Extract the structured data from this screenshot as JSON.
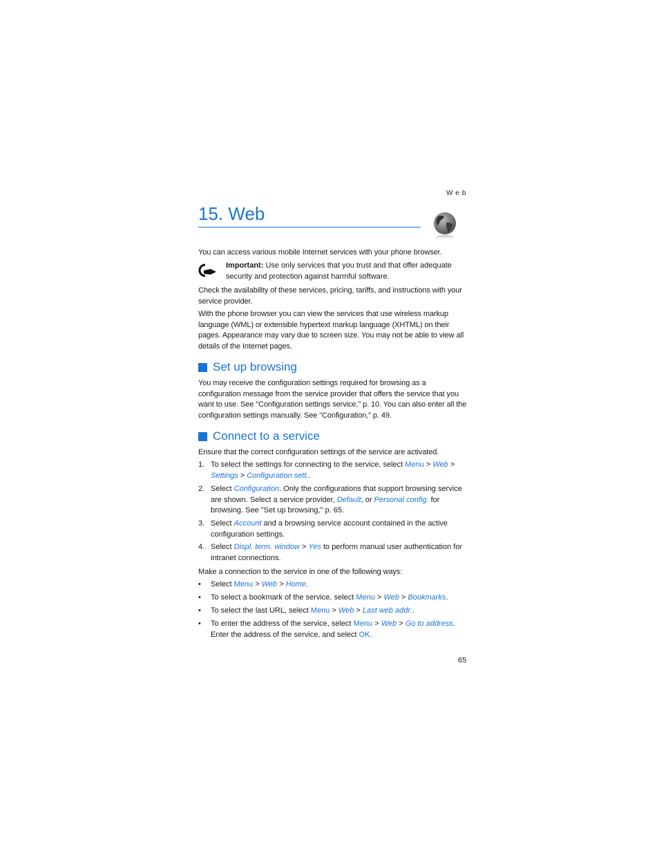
{
  "running_head": "Web",
  "chapter": {
    "title": "15. Web",
    "icon": "globe-icon"
  },
  "intro": "You can access various mobile Internet services with your phone browser.",
  "important": {
    "icon": "important-hand-icon",
    "label": "Important:",
    "text": " Use only services that you trust and that offer adequate security and protection against harmful software."
  },
  "para_check": "Check the availability of these services, pricing, tariffs, and instructions with your service provider.",
  "para_browser": "With the phone browser you can view the services that use wireless markup language (WML) or extensible hypertext markup language (XHTML) on their pages. Appearance may vary due to screen size. You may not be able to view all details of the Internet pages.",
  "sections": {
    "setup": {
      "heading": "Set up browsing",
      "text": "You may receive the configuration settings required for browsing as a configuration message from the service provider that offers the service that you want to use. See \"Configuration settings service,\" p. 10. You can also enter all the configuration settings manually. See \"Configuration,\" p. 49."
    },
    "connect": {
      "heading": "Connect to a service",
      "intro": "Ensure that the correct configuration settings of the service are activated.",
      "steps": [
        {
          "num": "1.",
          "t1": "To select the settings for connecting to the service, select ",
          "menu": "Menu",
          "sep1": " > ",
          "web": "Web",
          "sep2": " > ",
          "settings": "Settings",
          "sep3": " > ",
          "config": "Configuration sett.",
          "end": "."
        },
        {
          "num": "2.",
          "t1": "Select ",
          "configuration": "Configuration",
          "t2": ". Only the configurations that support browsing service are shown. Select a service provider, ",
          "default": "Default",
          "t3": ", or ",
          "personal": "Personal config.",
          "t4": " for browsing. See \"Set up browsing,\" p. 65."
        },
        {
          "num": "3.",
          "t1": "Select ",
          "account": "Account",
          "t2": " and a browsing service account contained in the active configuration settings."
        },
        {
          "num": "4.",
          "t1": "Select ",
          "displ": "Displ. term. window",
          "sep": " > ",
          "yes": "Yes",
          "t2": " to perform manual user authentication for intranet connections."
        }
      ],
      "ways_intro": "Make a connection to the service in one of the following ways:",
      "ways": [
        {
          "t1": "Select ",
          "menu": "Menu",
          "sep1": " > ",
          "web": "Web",
          "sep2": " > ",
          "target": "Home",
          "end": "."
        },
        {
          "t1": "To select a bookmark of the service, select ",
          "menu": "Menu",
          "sep1": " > ",
          "web": "Web",
          "sep2": " > ",
          "target": "Bookmarks",
          "end": "."
        },
        {
          "t1": "To select the last URL, select ",
          "menu": "Menu",
          "sep1": " > ",
          "web": "Web",
          "sep2": " > ",
          "target": "Last web addr.",
          "end": "."
        },
        {
          "t1": "To enter the address of the service, select ",
          "menu": "Menu",
          "sep1": " > ",
          "web": "Web",
          "sep2": " > ",
          "target": "Go to address",
          "end": ". Enter the address of the service, and select ",
          "ok": "OK",
          "end2": "."
        }
      ]
    }
  },
  "page_number": "65",
  "colors": {
    "accent": "#1a73d9",
    "text": "#1a1a1a"
  }
}
